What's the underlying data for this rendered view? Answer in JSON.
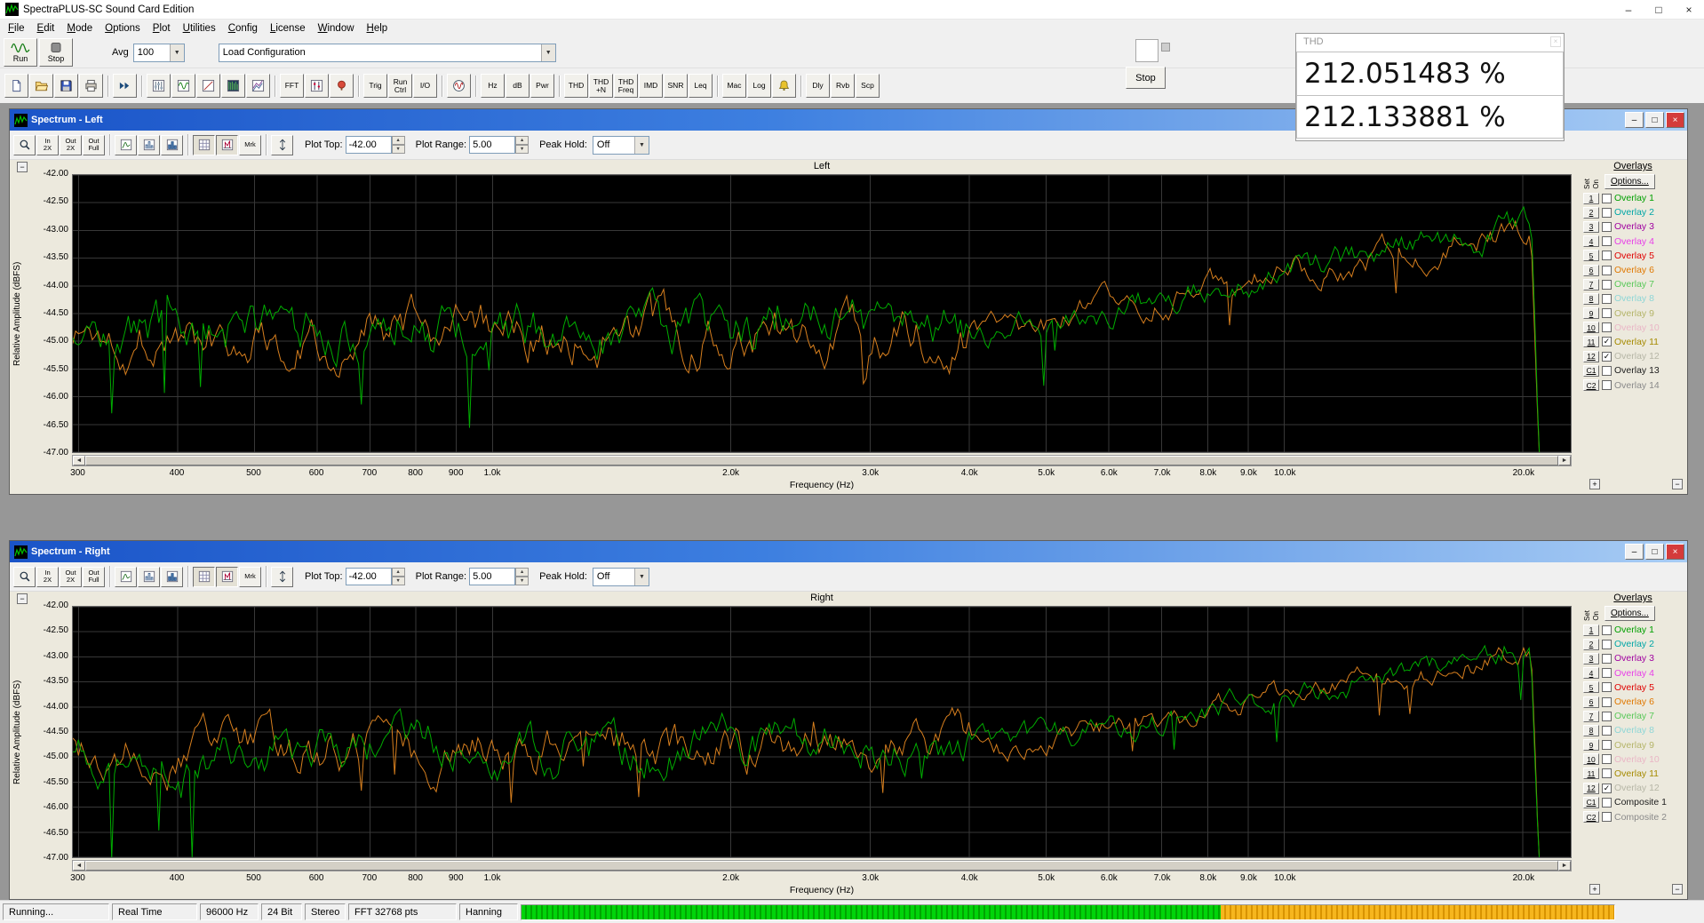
{
  "app": {
    "title": "SpectraPLUS-SC Sound Card Edition",
    "window_controls": [
      {
        "name": "minimize-button",
        "glyph": "–"
      },
      {
        "name": "maximize-button",
        "glyph": "□"
      },
      {
        "name": "close-button",
        "glyph": "×"
      }
    ]
  },
  "menu": [
    "File",
    "Edit",
    "Mode",
    "Options",
    "Plot",
    "Utilities",
    "Config",
    "License",
    "Window",
    "Help"
  ],
  "glyphs": {
    "dropdown": "▼",
    "spin_up": "▲",
    "spin_down": "▼",
    "scroll_left": "◄",
    "scroll_right": "►",
    "minus": "−",
    "plus": "+",
    "win_minimize": "–",
    "win_restore": "□",
    "win_close": "×",
    "check": "✓"
  },
  "toolbar_main": {
    "run_label": "Run",
    "stop_label": "Stop",
    "avg_label": "Avg",
    "avg_value": "100",
    "config_value": "Load Configuration"
  },
  "toolbar_icons": [
    {
      "name": "new-file-icon"
    },
    {
      "name": "open-file-icon"
    },
    {
      "name": "save-icon"
    },
    {
      "name": "print-icon"
    },
    {
      "sep": true
    },
    {
      "name": "fast-forward-icon"
    },
    {
      "sep": true
    },
    {
      "name": "mixer-icon"
    },
    {
      "name": "time-series-icon"
    },
    {
      "name": "phase-plot-icon"
    },
    {
      "name": "spectrogram-icon"
    },
    {
      "name": "surface-plot-icon"
    },
    {
      "sep": true
    },
    {
      "name": "fft-settings-button",
      "label": "FFT"
    },
    {
      "name": "markers-icon"
    },
    {
      "name": "calibration-icon"
    },
    {
      "sep": true
    },
    {
      "name": "trigger-button",
      "label": "Trig"
    },
    {
      "name": "run-control-button",
      "label": "Run\nCtrl"
    },
    {
      "name": "io-device-button",
      "label": "I/O"
    },
    {
      "sep": true
    },
    {
      "name": "signal-generator-icon"
    },
    {
      "sep": true
    },
    {
      "name": "frequency-units-button",
      "label": "Hz"
    },
    {
      "name": "amplitude-units-button",
      "label": "dB"
    },
    {
      "name": "power-units-button",
      "label": "Pwr"
    },
    {
      "sep": true
    },
    {
      "name": "thd-button",
      "label": "THD"
    },
    {
      "name": "thd-n-button",
      "label": "THD\n+N"
    },
    {
      "name": "thd-freq-button",
      "label": "THD\nFreq"
    },
    {
      "name": "imd-button",
      "label": "IMD"
    },
    {
      "name": "snr-button",
      "label": "SNR"
    },
    {
      "name": "leq-button",
      "label": "Leq"
    },
    {
      "sep": true
    },
    {
      "name": "macro-button",
      "label": "Mac"
    },
    {
      "name": "log-button",
      "label": "Log"
    },
    {
      "name": "alarm-bell-icon"
    },
    {
      "sep": true
    },
    {
      "name": "delay-button",
      "label": "Dly"
    },
    {
      "name": "reverb-button",
      "label": "Rvb"
    },
    {
      "name": "scope-button",
      "label": "Scp"
    }
  ],
  "plot_toolbar": {
    "buttons": [
      {
        "name": "zoom-icon"
      },
      {
        "name": "zoom-in-2x-button",
        "label": "In\n2X"
      },
      {
        "name": "zoom-out-2x-button",
        "label": "Out\n2X"
      },
      {
        "name": "zoom-out-full-button",
        "label": "Out\nFull"
      },
      {
        "sep": true
      },
      {
        "name": "line-plot-icon"
      },
      {
        "name": "bar-plot-icon"
      },
      {
        "name": "filled-plot-icon"
      },
      {
        "sep": true
      },
      {
        "name": "grid-toggle-icon",
        "pressed": true
      },
      {
        "name": "labels-toggle-icon",
        "pressed": true
      },
      {
        "name": "marker-button",
        "label": "Mrk"
      },
      {
        "sep": true
      },
      {
        "name": "vertical-fit-icon"
      }
    ]
  },
  "thd_panel": {
    "title": "THD",
    "value_left": "212.051483 %",
    "value_right": "212.133881 %"
  },
  "floating_stop": {
    "label": "Stop"
  },
  "windows": [
    {
      "title": "Spectrum - Left",
      "plot_title": "Left",
      "ylabel": "Relative Amplitude (dBFS)",
      "xlabel": "Frequency (Hz)",
      "toolbar": {
        "plot_top_label": "Plot Top:",
        "plot_top": "-42.00",
        "plot_range_label": "Plot Range:",
        "plot_range": "5.00",
        "peak_hold_label": "Peak Hold:",
        "peak_hold": "Off"
      },
      "overlays": {
        "header": "Overlays",
        "set_label": "Set",
        "on_label": "On",
        "options_label": "Options...",
        "items": [
          {
            "key": "1",
            "label": "Overlay 1",
            "color": "#00a000",
            "checked": false
          },
          {
            "key": "2",
            "label": "Overlay 2",
            "color": "#00a6a6",
            "checked": false
          },
          {
            "key": "3",
            "label": "Overlay 3",
            "color": "#a000a0",
            "checked": false
          },
          {
            "key": "4",
            "label": "Overlay 4",
            "color": "#e83ee8",
            "checked": false
          },
          {
            "key": "5",
            "label": "Overlay 5",
            "color": "#e00000",
            "checked": false
          },
          {
            "key": "6",
            "label": "Overlay 6",
            "color": "#e07800",
            "checked": false
          },
          {
            "key": "7",
            "label": "Overlay 7",
            "color": "#58c858",
            "checked": false
          },
          {
            "key": "8",
            "label": "Overlay 8",
            "color": "#8ed6d6",
            "checked": false
          },
          {
            "key": "9",
            "label": "Overlay 9",
            "color": "#b4b468",
            "checked": false
          },
          {
            "key": "10",
            "label": "Overlay 10",
            "color": "#eab6c6",
            "checked": false
          },
          {
            "key": "11",
            "label": "Overlay 11",
            "color": "#a58a00",
            "checked": true
          },
          {
            "key": "12",
            "label": "Overlay 12",
            "color": "#b6b6a6",
            "checked": true
          },
          {
            "key": "C1",
            "label": "Overlay 13",
            "color": "#202020",
            "checked": false
          },
          {
            "key": "C2",
            "label": "Overlay 14",
            "color": "#8a8a8a",
            "checked": false
          }
        ]
      }
    },
    {
      "title": "Spectrum - Right",
      "plot_title": "Right",
      "ylabel": "Relative Amplitude (dBFS)",
      "xlabel": "Frequency (Hz)",
      "toolbar": {
        "plot_top_label": "Plot Top:",
        "plot_top": "-42.00",
        "plot_range_label": "Plot Range:",
        "plot_range": "5.00",
        "peak_hold_label": "Peak Hold:",
        "peak_hold": "Off"
      },
      "overlays": {
        "header": "Overlays",
        "set_label": "Set",
        "on_label": "On",
        "options_label": "Options...",
        "items": [
          {
            "key": "1",
            "label": "Overlay 1",
            "color": "#00a000",
            "checked": false
          },
          {
            "key": "2",
            "label": "Overlay 2",
            "color": "#00a6a6",
            "checked": false
          },
          {
            "key": "3",
            "label": "Overlay 3",
            "color": "#a000a0",
            "checked": false
          },
          {
            "key": "4",
            "label": "Overlay 4",
            "color": "#e83ee8",
            "checked": false
          },
          {
            "key": "5",
            "label": "Overlay 5",
            "color": "#e00000",
            "checked": false
          },
          {
            "key": "6",
            "label": "Overlay 6",
            "color": "#e07800",
            "checked": false
          },
          {
            "key": "7",
            "label": "Overlay 7",
            "color": "#58c858",
            "checked": false
          },
          {
            "key": "8",
            "label": "Overlay 8",
            "color": "#8ed6d6",
            "checked": false
          },
          {
            "key": "9",
            "label": "Overlay 9",
            "color": "#b4b468",
            "checked": false
          },
          {
            "key": "10",
            "label": "Overlay 10",
            "color": "#eab6c6",
            "checked": false
          },
          {
            "key": "11",
            "label": "Overlay 11",
            "color": "#a58a00",
            "checked": false
          },
          {
            "key": "12",
            "label": "Overlay 12",
            "color": "#b6b6a6",
            "checked": true
          },
          {
            "key": "C1",
            "label": "Composite 1",
            "color": "#202020",
            "checked": false
          },
          {
            "key": "C2",
            "label": "Composite 2",
            "color": "#8a8a8a",
            "checked": false
          }
        ]
      }
    }
  ],
  "chart_data": {
    "type": "line",
    "x_scale": "log",
    "xlim": [
      295,
      23000
    ],
    "ylim": [
      -47,
      -42
    ],
    "xlabel": "Frequency (Hz)",
    "ylabel": "Relative Amplitude (dBFS)",
    "plots": [
      "Left",
      "Right"
    ],
    "x_ticks": [
      {
        "v": 300,
        "label": "300"
      },
      {
        "v": 400,
        "label": "400"
      },
      {
        "v": 500,
        "label": "500"
      },
      {
        "v": 600,
        "label": "600"
      },
      {
        "v": 700,
        "label": "700"
      },
      {
        "v": 800,
        "label": "800"
      },
      {
        "v": 900,
        "label": "900"
      },
      {
        "v": 1000,
        "label": "1.0k"
      },
      {
        "v": 2000,
        "label": "2.0k"
      },
      {
        "v": 3000,
        "label": "3.0k"
      },
      {
        "v": 4000,
        "label": "4.0k"
      },
      {
        "v": 5000,
        "label": "5.0k"
      },
      {
        "v": 6000,
        "label": "6.0k"
      },
      {
        "v": 7000,
        "label": "7.0k"
      },
      {
        "v": 8000,
        "label": "8.0k"
      },
      {
        "v": 9000,
        "label": "9.0k"
      },
      {
        "v": 10000,
        "label": "10.0k"
      },
      {
        "v": 20000,
        "label": "20.0k"
      }
    ],
    "y_ticks": [
      "-42.00",
      "-42.50",
      "-43.00",
      "-43.50",
      "-44.00",
      "-44.50",
      "-45.00",
      "-45.50",
      "-46.00",
      "-46.50",
      "-47.00"
    ],
    "grid_color": "#383838",
    "series": [
      {
        "plot": "Left",
        "name": "overlay-11-orange",
        "color": "#d77f1e",
        "seed": 1337,
        "low_dips": false
      },
      {
        "plot": "Left",
        "name": "overlay-1-green",
        "color": "#00ad00",
        "seed": 903,
        "low_dips": true
      },
      {
        "plot": "Right",
        "name": "overlay-11-orange",
        "color": "#d77f1e",
        "seed": 512,
        "low_dips": false
      },
      {
        "plot": "Right",
        "name": "overlay-1-green",
        "color": "#00ad00",
        "seed": 77,
        "low_dips": true
      }
    ],
    "profile": {
      "baseline": -44.85,
      "rise_start": 4300,
      "rise_end": 20000,
      "end_level": -42.95,
      "cutoff": 20500,
      "floor": -47.4
    }
  },
  "statusbar": {
    "cells": [
      "Running...",
      "Real Time",
      "96000 Hz",
      "24 Bit",
      "Stereo",
      "FFT 32768 pts",
      "Hanning"
    ],
    "meter": {
      "green_pct": 64,
      "orange_pct": 36
    }
  }
}
